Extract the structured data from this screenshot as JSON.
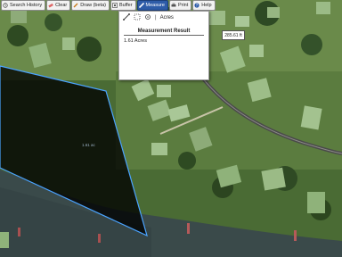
{
  "toolbar": {
    "search_history": "Search History",
    "clear": "Clear",
    "draw": "Draw (beta)",
    "buffer": "Buffer",
    "measure": "Measure",
    "print": "Print",
    "help": "Help"
  },
  "measure_popup": {
    "units": "Acres",
    "result_title": "Measurement Result",
    "result_value": "1.61 Acres"
  },
  "map": {
    "segment_length": "285.61 ft",
    "area_label": "1.61 ac"
  },
  "colors": {
    "measure_active": "#2e5ca8",
    "polygon_stroke": "#4aa3ff",
    "polygon_fill": "#000000"
  }
}
